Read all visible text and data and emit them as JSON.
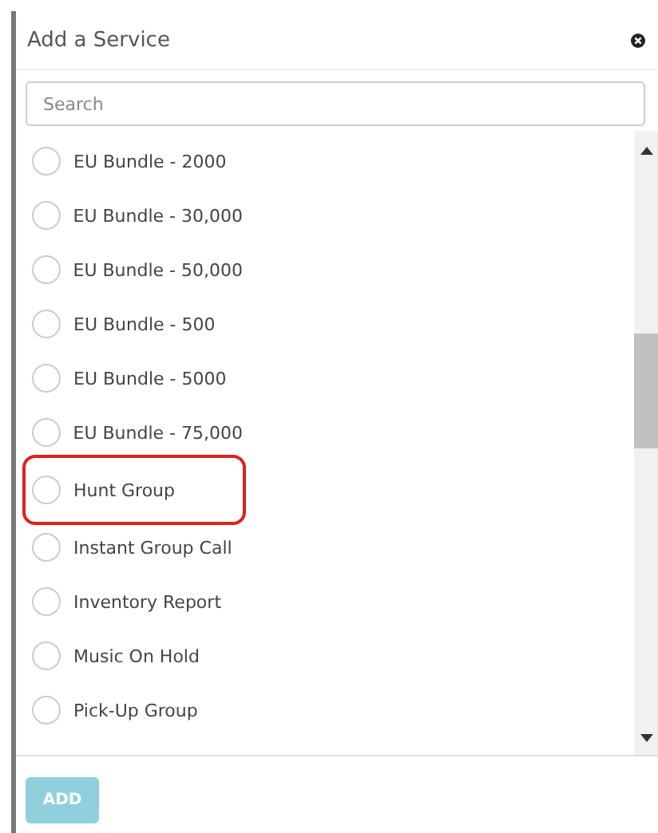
{
  "dialog": {
    "title": "Add a Service"
  },
  "search": {
    "placeholder": "Search"
  },
  "services": [
    {
      "label": "EU Bundle - 2000",
      "selected": false,
      "highlighted": false
    },
    {
      "label": "EU Bundle - 30,000",
      "selected": false,
      "highlighted": false
    },
    {
      "label": "EU Bundle - 50,000",
      "selected": false,
      "highlighted": false
    },
    {
      "label": "EU Bundle - 500",
      "selected": false,
      "highlighted": false
    },
    {
      "label": "EU Bundle - 5000",
      "selected": false,
      "highlighted": false
    },
    {
      "label": "EU Bundle - 75,000",
      "selected": false,
      "highlighted": false
    },
    {
      "label": "Hunt Group",
      "selected": false,
      "highlighted": true
    },
    {
      "label": "Instant Group Call",
      "selected": false,
      "highlighted": false
    },
    {
      "label": "Inventory Report",
      "selected": false,
      "highlighted": false
    },
    {
      "label": "Music On Hold",
      "selected": false,
      "highlighted": false
    },
    {
      "label": "Pick-Up Group",
      "selected": false,
      "highlighted": false
    }
  ],
  "add_button": {
    "label": "ADD",
    "disabled": true
  }
}
